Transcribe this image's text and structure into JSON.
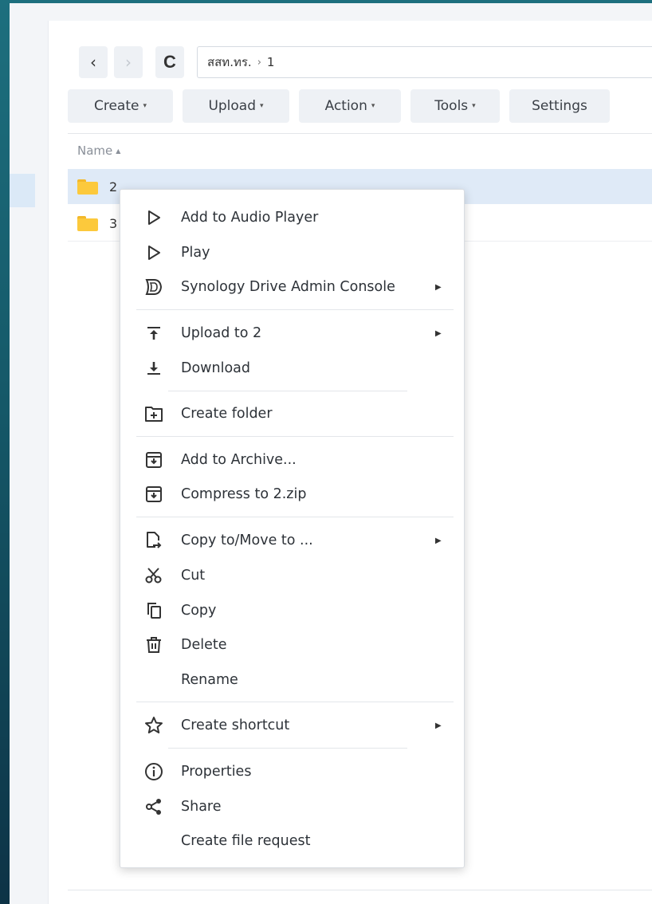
{
  "navigation": {
    "back_label": "‹",
    "forward_label": "›",
    "refresh_label": "C",
    "path": [
      "สสท.ทร.",
      "1"
    ],
    "path_separator": "›"
  },
  "toolbar": {
    "create_label": "Create",
    "upload_label": "Upload",
    "action_label": "Action",
    "tools_label": "Tools",
    "settings_label": "Settings",
    "caret": "▾"
  },
  "file_list": {
    "column_name": "Name",
    "sort_indicator": "▲",
    "rows": [
      {
        "name": "2",
        "selected": true
      },
      {
        "name": "3",
        "selected": false
      }
    ]
  },
  "context_menu": {
    "submenu_arrow": "▶",
    "items": [
      {
        "label": "Add to Audio Player",
        "icon": "play-outline-icon"
      },
      {
        "label": "Play",
        "icon": "play-outline-icon"
      },
      {
        "label": "Synology Drive Admin Console",
        "icon": "synology-drive-icon",
        "submenu": true
      },
      {
        "label": "Upload to 2",
        "icon": "upload-icon",
        "submenu": true
      },
      {
        "label": "Download",
        "icon": "download-icon"
      },
      {
        "label": "Create folder",
        "icon": "new-folder-icon"
      },
      {
        "label": "Add to Archive...",
        "icon": "archive-icon"
      },
      {
        "label": "Compress to 2.zip",
        "icon": "archive-icon"
      },
      {
        "label": "Copy to/Move to ...",
        "icon": "copy-move-icon",
        "submenu": true
      },
      {
        "label": "Cut",
        "icon": "scissors-icon"
      },
      {
        "label": "Copy",
        "icon": "copy-icon"
      },
      {
        "label": "Delete",
        "icon": "trash-icon"
      },
      {
        "label": "Rename",
        "icon": ""
      },
      {
        "label": "Create shortcut",
        "icon": "star-icon",
        "submenu": true
      },
      {
        "label": "Properties",
        "icon": "info-icon"
      },
      {
        "label": "Share",
        "icon": "share-icon"
      },
      {
        "label": "Create file request",
        "icon": ""
      }
    ]
  },
  "colors": {
    "background_gradient_top": "#1d6f7e",
    "selection": "#dfeaf7",
    "folder": "#fcc93c",
    "button_bg": "#eef1f5"
  }
}
